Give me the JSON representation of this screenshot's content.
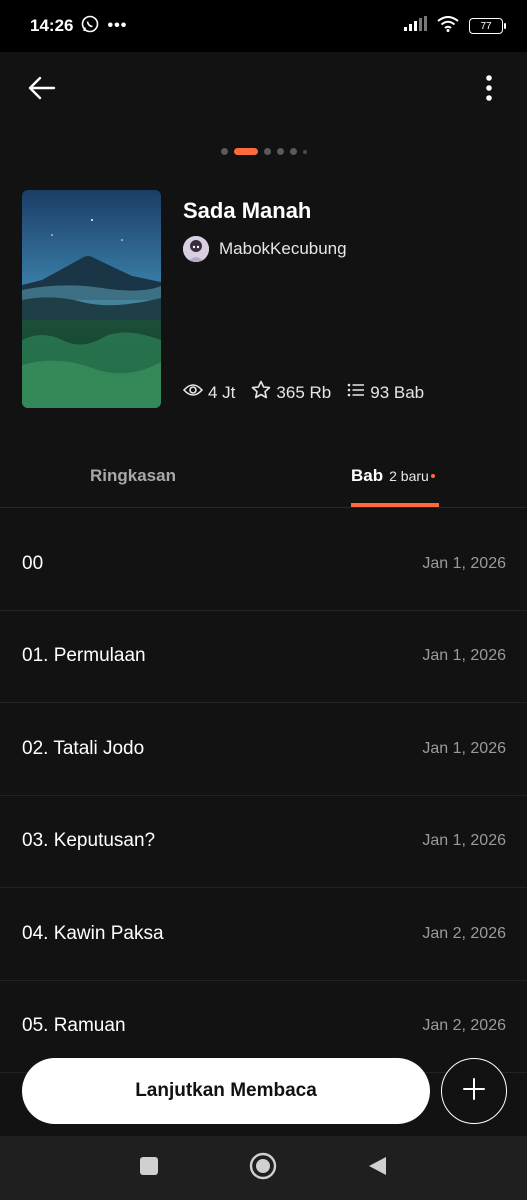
{
  "status_bar": {
    "time": "14:26",
    "icons": [
      "whatsapp-icon",
      "more-notifications-icon",
      "signal-icon",
      "wifi-icon",
      "battery-icon"
    ],
    "battery": "77"
  },
  "app_bar": {
    "back_icon": "arrow-left-icon",
    "more_icon": "more-vertical-icon"
  },
  "book": {
    "title": "Sada Manah",
    "author": "MabokKecubung",
    "views": "4 Jt",
    "votes": "365 Rb",
    "chapters": "93 Bab"
  },
  "tabs": {
    "summary": "Ringkasan",
    "chapters": "Bab",
    "chapters_badge": "2 baru"
  },
  "chapter_list": [
    {
      "name": "00",
      "date": "Jan 1, 2026"
    },
    {
      "name": "01. Permulaan",
      "date": "Jan 1, 2026"
    },
    {
      "name": "02. Tatali Jodo",
      "date": "Jan 1, 2026"
    },
    {
      "name": "03. Keputusan?",
      "date": "Jan 1, 2026"
    },
    {
      "name": "04. Kawin Paksa",
      "date": "Jan 2, 2026"
    },
    {
      "name": "05. Ramuan",
      "date": "Jan 2, 2026"
    }
  ],
  "actions": {
    "continue_label": "Lanjutkan Membaca",
    "add_icon": "plus-icon"
  },
  "colors": {
    "accent": "#ff6a3d",
    "background": "#121212"
  }
}
